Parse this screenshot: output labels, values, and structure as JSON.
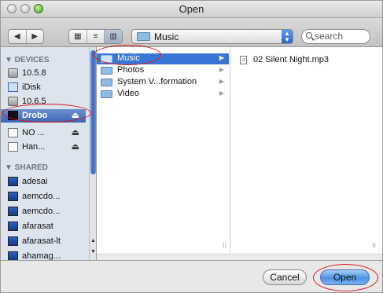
{
  "window": {
    "title": "Open"
  },
  "toolbar": {
    "nav": [
      "◀",
      "▶"
    ],
    "view_modes": [
      "▦",
      "≡",
      "▥"
    ],
    "path_label": "Music",
    "search_placeholder": "search"
  },
  "sidebar": {
    "devices_header": "▼ DEVICES",
    "devices": [
      {
        "label": "10.5.8",
        "icon": "hard-disk-icon"
      },
      {
        "label": "iDisk",
        "icon": "idisk-icon"
      },
      {
        "label": "10.6.5",
        "icon": "hard-disk-icon"
      },
      {
        "label": "Drobo",
        "icon": "drobo-icon",
        "eject": "⏏",
        "selected": true
      },
      {
        "label": "NO ...",
        "icon": "external-disk-icon",
        "eject": "⏏"
      },
      {
        "label": "Han...",
        "icon": "external-disk-icon",
        "eject": "⏏"
      }
    ],
    "shared_header": "▼ SHARED",
    "shared": [
      {
        "label": "adesai"
      },
      {
        "label": "aemcdo..."
      },
      {
        "label": "aemcdo..."
      },
      {
        "label": "afarasat"
      },
      {
        "label": "afarasat-lt"
      },
      {
        "label": "ahamag..."
      }
    ]
  },
  "browser": {
    "column1": [
      {
        "label": "Music",
        "selected": true
      },
      {
        "label": "Photos"
      },
      {
        "label": "System V...formation"
      },
      {
        "label": "Video"
      }
    ],
    "column2": [
      {
        "label": "02 Silent Night.mp3",
        "icon": "music-file-icon"
      }
    ]
  },
  "buttons": {
    "cancel": "Cancel",
    "open": "Open"
  },
  "glyphs": {
    "chevron": "▶",
    "grip": "II",
    "music_note": "♫",
    "up": "▲",
    "down": "▼"
  }
}
